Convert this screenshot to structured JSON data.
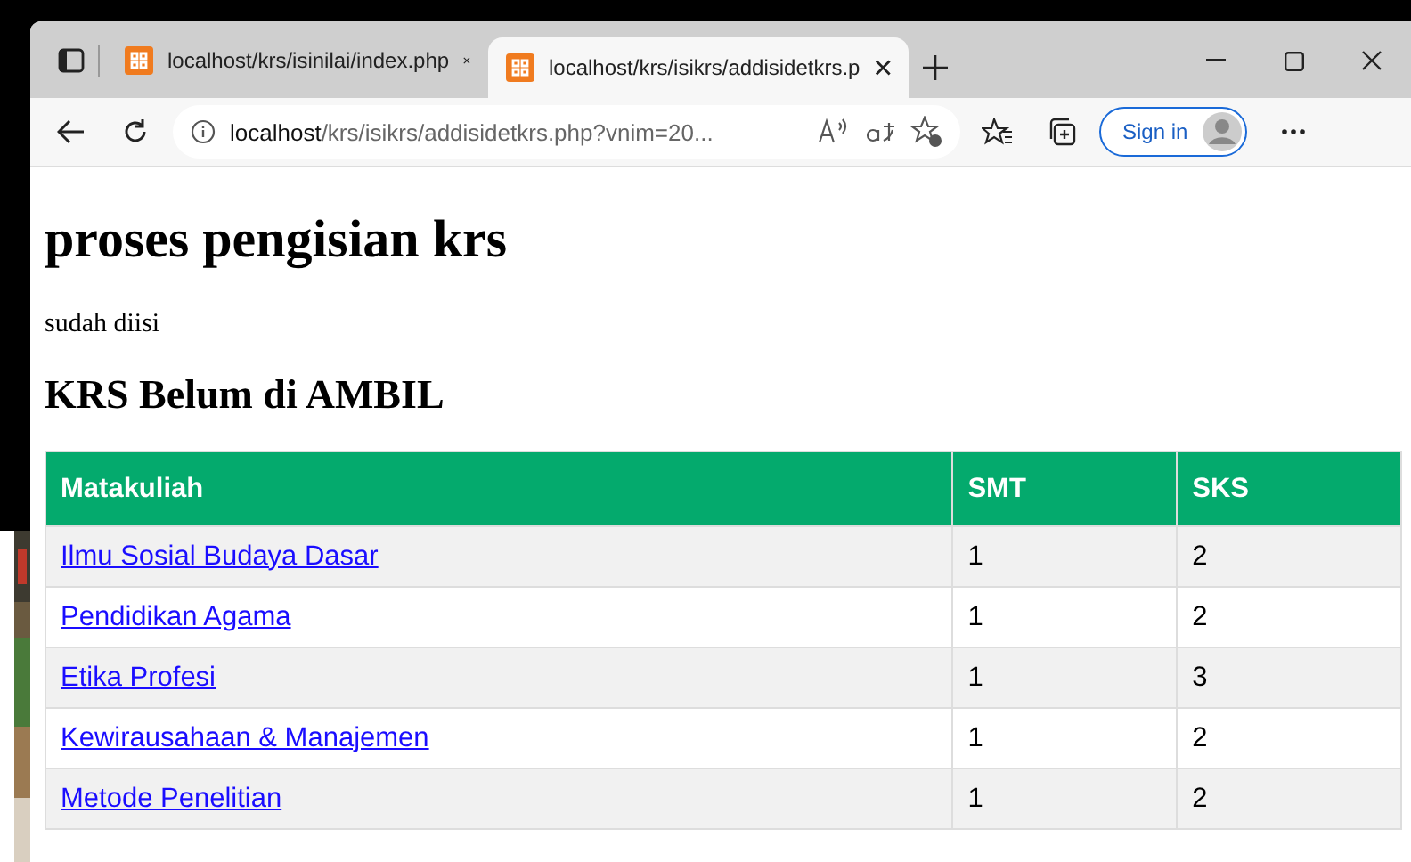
{
  "tabs": [
    {
      "title": "localhost/krs/isinilai/index.php",
      "selected": false
    },
    {
      "title": "localhost/krs/isikrs/addisidetkrs.p",
      "selected": true
    }
  ],
  "address": {
    "host": "localhost",
    "path": "/krs/isikrs/addisidetkrs.php?vnim=20..."
  },
  "sign_in": "Sign in",
  "page": {
    "title": "proses pengisian krs",
    "message": "sudah diisi",
    "subtitle": "KRS Belum di AMBIL"
  },
  "table": {
    "columns": [
      "Matakuliah",
      "SMT",
      "SKS"
    ],
    "rows": [
      [
        "Ilmu Sosial Budaya Dasar",
        "1",
        "2"
      ],
      [
        "Pendidikan Agama",
        "1",
        "2"
      ],
      [
        "Etika Profesi",
        "1",
        "3"
      ],
      [
        "Kewirausahaan & Manajemen",
        "1",
        "2"
      ],
      [
        "Metode Penelitian",
        "1",
        "2"
      ]
    ]
  }
}
